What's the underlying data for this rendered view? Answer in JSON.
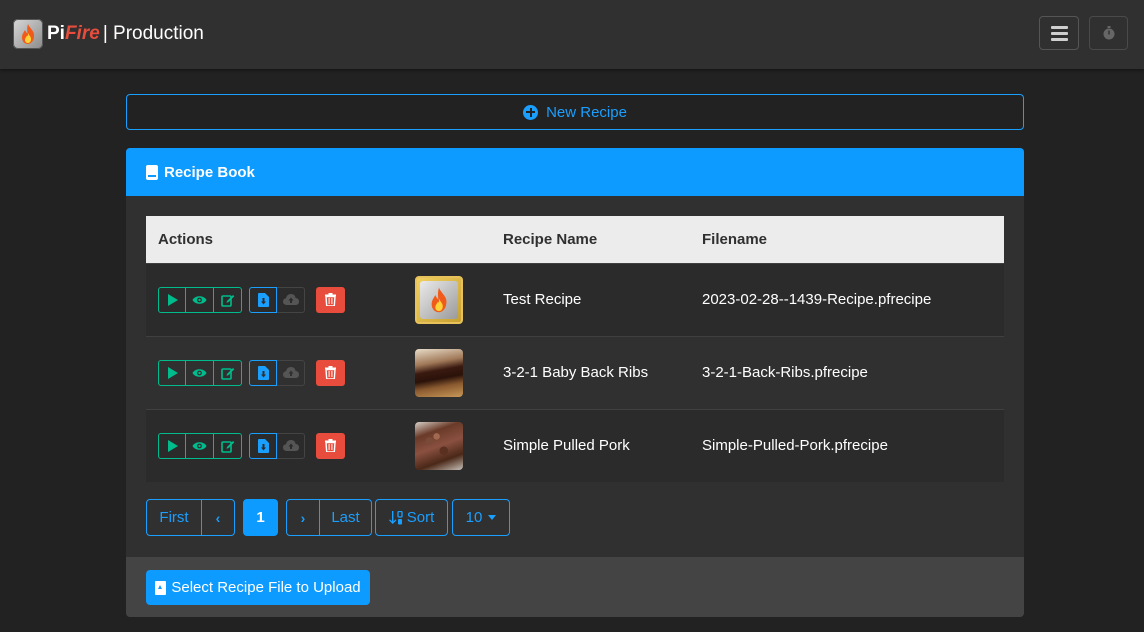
{
  "navbar": {
    "brand_pi": "Pi",
    "brand_fire": "Fire",
    "brand_rest": "| Production",
    "menu_icon": "hamburger-icon",
    "timer_icon": "stopwatch-icon"
  },
  "new_recipe": {
    "label": "New Recipe",
    "icon": "plus-circle-icon"
  },
  "recipe_book": {
    "title": "Recipe Book",
    "icon": "book-icon",
    "columns": {
      "actions": "Actions",
      "image": "",
      "name": "Recipe Name",
      "filename": "Filename"
    },
    "rows": [
      {
        "name": "Test Recipe",
        "filename": "2023-02-28--1439-Recipe.pfrecipe",
        "thumbnail": "pifire-logo"
      },
      {
        "name": "3-2-1 Baby Back Ribs",
        "filename": "3-2-1-Back-Ribs.pfrecipe",
        "thumbnail": "ribs-photo"
      },
      {
        "name": "Simple Pulled Pork",
        "filename": "Simple-Pulled-Pork.pfrecipe",
        "thumbnail": "pulled-pork-photo"
      }
    ],
    "row_actions": [
      "play-icon",
      "eye-icon",
      "edit-icon",
      "download-file-icon",
      "cloud-upload-icon",
      "trash-icon"
    ],
    "pagination": {
      "first": "First",
      "prev": "‹",
      "current": "1",
      "next": "›",
      "last": "Last",
      "sort": "Sort",
      "page_size": "10"
    },
    "upload_label": "Select Recipe File to Upload"
  },
  "colors": {
    "background": "#222222",
    "navbar": "#303030",
    "primary": "#0d9bff",
    "success": "#00bc8c",
    "danger": "#e74c3c",
    "fire": "#e74c3c"
  }
}
